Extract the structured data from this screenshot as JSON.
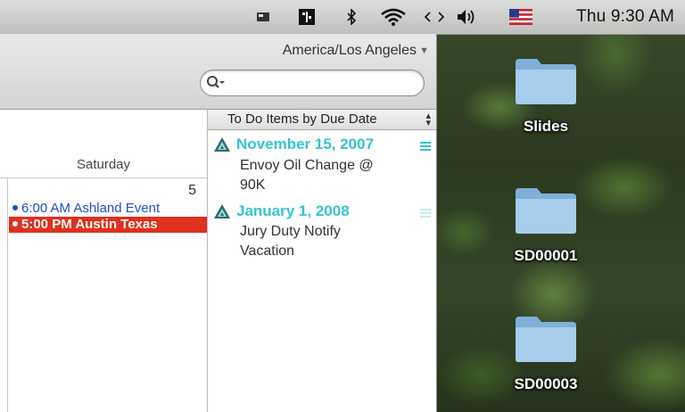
{
  "menubar": {
    "clock": "Thu 9:30 AM",
    "icons": [
      "flag-icon",
      "calendar-icon",
      "bluetooth-icon",
      "wifi-icon",
      "sync-icon",
      "volume-icon",
      "us-flag-icon"
    ]
  },
  "toolbar": {
    "timezone": "America/Los Angeles",
    "search": {
      "value": "",
      "placeholder": ""
    }
  },
  "calendar": {
    "day_name": "Saturday",
    "day_number": "5",
    "events": [
      {
        "time": "6:00 AM",
        "title": "Ashland Event",
        "color": "#1f4fc9"
      },
      {
        "time": "5:00 PM",
        "title": "Austin Texas",
        "color": "#e0301e"
      }
    ]
  },
  "todo": {
    "header": "To Do Items by Due Date",
    "groups": [
      {
        "date": "November 15, 2007",
        "item_line1": "Envoy Oil Change @",
        "item_line2": "90K"
      },
      {
        "date": "January 1, 2008",
        "item_line1": "Jury Duty Notify",
        "item_line2": "Vacation"
      }
    ],
    "accent_color": "#35c4d0"
  },
  "desktop": {
    "items": [
      {
        "label": "Slides"
      },
      {
        "label": "SD00001"
      },
      {
        "label": "SD00003"
      }
    ]
  }
}
